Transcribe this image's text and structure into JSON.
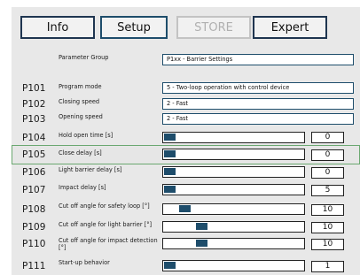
{
  "tabs": [
    {
      "label": "Info",
      "state": "normal"
    },
    {
      "label": "Setup",
      "state": "active"
    },
    {
      "label": "STORE",
      "state": "disabled"
    },
    {
      "label": "Expert",
      "state": "normal"
    }
  ],
  "group": {
    "label": "Parameter Group",
    "value": "P1xx - Barrier Settings"
  },
  "params": [
    {
      "code": "P101",
      "label": "Program mode",
      "type": "select",
      "value": "5 - Two-loop operation with control device"
    },
    {
      "code": "P102",
      "label": "Closing speed",
      "type": "select",
      "value": "2 - Fast"
    },
    {
      "code": "P103",
      "label": "Opening speed",
      "type": "select",
      "value": "2 - Fast"
    },
    {
      "code": "P104",
      "label": "Hold open time [s]",
      "type": "slider",
      "value": "0",
      "level": 0.0
    },
    {
      "code": "P105",
      "label": "Close delay [s]",
      "type": "slider",
      "value": "0",
      "level": 0.0,
      "highlighted": true
    },
    {
      "code": "P106",
      "label": "Light barrier delay [s]",
      "type": "slider",
      "value": "0",
      "level": 0.0
    },
    {
      "code": "P107",
      "label": "Impact delay [s]",
      "type": "slider",
      "value": "5",
      "level": 0.0
    },
    {
      "code": "P108",
      "label": "Cut off angle for safety loop [°]",
      "type": "slider",
      "value": "10",
      "level": 0.12
    },
    {
      "code": "P109",
      "label": "Cut off angle for light barrier [°]",
      "type": "slider",
      "value": "10",
      "level": 0.25
    },
    {
      "code": "P110",
      "label": "Cut off angle for impact detection [°]",
      "type": "slider",
      "value": "10",
      "level": 0.25
    },
    {
      "code": "P111",
      "label": "Start-up behavior",
      "type": "slider",
      "value": "1",
      "level": 0.0
    }
  ],
  "colors": {
    "accent": "#1e4d6b",
    "highlight_border": "#6aa870",
    "panel": "#e8e8e8"
  }
}
